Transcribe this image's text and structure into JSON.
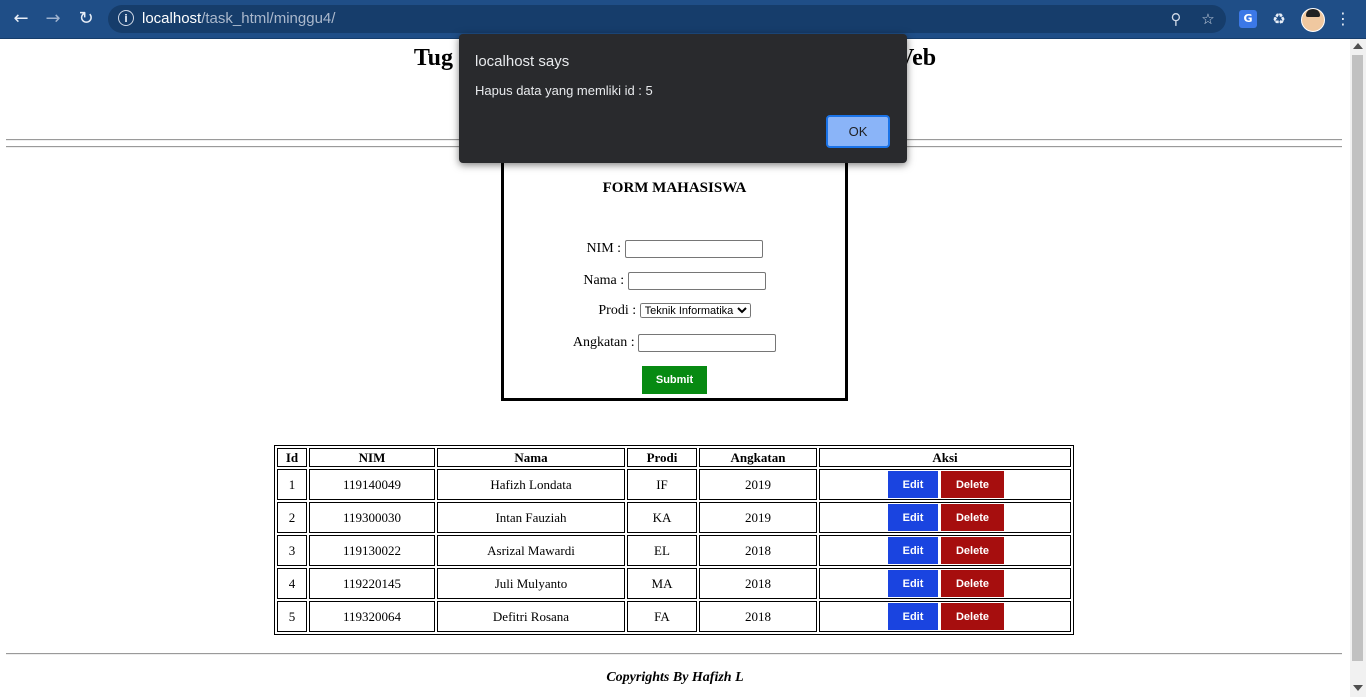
{
  "browser": {
    "url_host": "localhost",
    "url_path": "/task_html/minggu4/"
  },
  "page": {
    "title_left": "Tug",
    "title_right": "Veb",
    "form": {
      "title": "FORM MAHASISWA",
      "nim_label": "NIM :",
      "nama_label": "Nama :",
      "prodi_label": "Prodi :",
      "prodi_selected": "Teknik Informatika",
      "angkatan_label": "Angkatan :",
      "submit_label": "Submit"
    },
    "table": {
      "headers": [
        "Id",
        "NIM",
        "Nama",
        "Prodi",
        "Angkatan",
        "Aksi"
      ],
      "edit_label": "Edit",
      "delete_label": "Delete",
      "rows": [
        {
          "id": "1",
          "nim": "119140049",
          "nama": "Hafizh Londata",
          "prodi": "IF",
          "angkatan": "2019"
        },
        {
          "id": "2",
          "nim": "119300030",
          "nama": "Intan Fauziah",
          "prodi": "KA",
          "angkatan": "2019"
        },
        {
          "id": "3",
          "nim": "119130022",
          "nama": "Asrizal Mawardi",
          "prodi": "EL",
          "angkatan": "2018"
        },
        {
          "id": "4",
          "nim": "119220145",
          "nama": "Juli Mulyanto",
          "prodi": "MA",
          "angkatan": "2018"
        },
        {
          "id": "5",
          "nim": "119320064",
          "nama": "Defitri Rosana",
          "prodi": "FA",
          "angkatan": "2018"
        }
      ]
    },
    "footer": "Copyrights By Hafizh L"
  },
  "dialog": {
    "title": "localhost says",
    "message": "Hapus data yang memliki id : 5",
    "ok_label": "OK"
  },
  "icons": {
    "back": "arrow-left-icon",
    "forward": "arrow-right-icon",
    "reload": "reload-icon",
    "info": "info-icon",
    "zoom": "zoom-icon",
    "bookmark": "star-icon",
    "translate": "translate-icon",
    "extensions": "puzzle-icon",
    "menu": "kebab-menu-icon"
  }
}
